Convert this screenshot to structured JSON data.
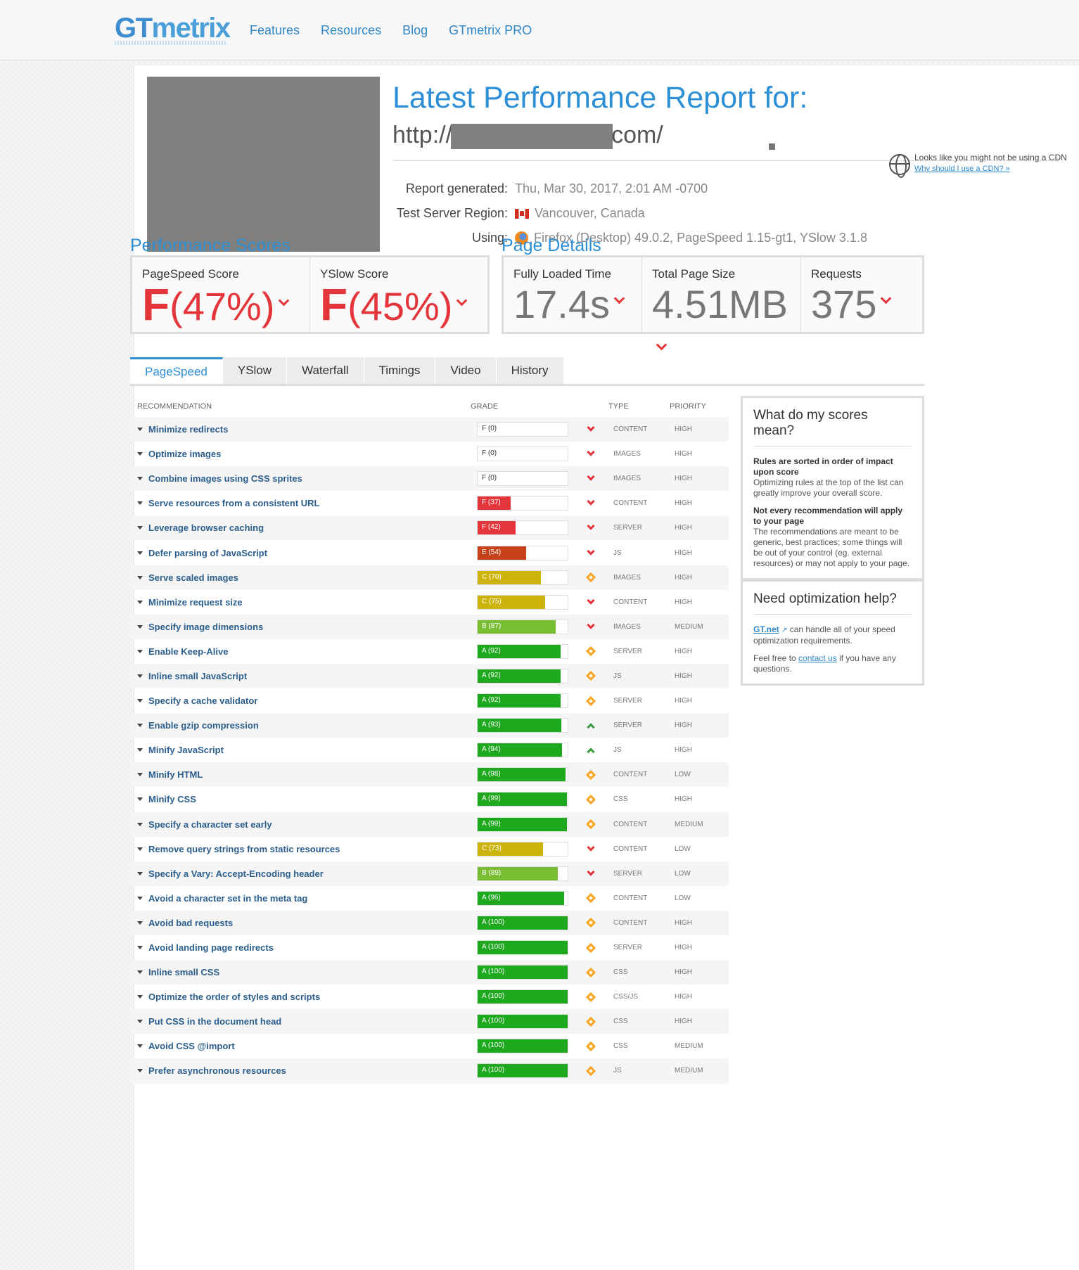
{
  "header": {
    "logo_gt": "GT",
    "logo_rest": "metrix",
    "nav": [
      "Features",
      "Resources",
      "Blog",
      "GTmetrix PRO"
    ]
  },
  "report": {
    "title": "Latest Performance Report for:",
    "url_prefix": "http://",
    "url_suffix": "com/",
    "generated_label": "Report generated:",
    "generated_value": "Thu, Mar 30, 2017, 2:01 AM -0700",
    "region_label": "Test Server Region:",
    "region_value": "Vancouver, Canada",
    "using_label": "Using:",
    "using_value": "Firefox (Desktop) 49.0.2, PageSpeed 1.15-gt1, YSlow 3.1.8",
    "cdn_text": "Looks like you might not be using a CDN",
    "cdn_link": "Why should I use a CDN? »"
  },
  "scores": {
    "heading": "Performance Scores",
    "pagespeed_label": "PageSpeed Score",
    "pagespeed_grade": "F",
    "pagespeed_pct": "(47%)",
    "yslow_label": "YSlow Score",
    "yslow_grade": "F",
    "yslow_pct": "(45%)"
  },
  "details": {
    "heading": "Page Details",
    "load_label": "Fully Loaded Time",
    "load_value": "17.4s",
    "size_label": "Total Page Size",
    "size_value": "4.51MB",
    "req_label": "Requests",
    "req_value": "375"
  },
  "tabs": [
    "PageSpeed",
    "YSlow",
    "Waterfall",
    "Timings",
    "Video",
    "History"
  ],
  "table": {
    "headers": {
      "rec": "RECOMMENDATION",
      "grade": "GRADE",
      "type": "TYPE",
      "priority": "PRIORITY"
    },
    "rows": [
      {
        "rec": "Minimize redirects",
        "grade": "F (0)",
        "score": 0,
        "color": "#e3353a",
        "ind": "down",
        "type": "CONTENT",
        "priority": "HIGH"
      },
      {
        "rec": "Optimize images",
        "grade": "F (0)",
        "score": 0,
        "color": "#e3353a",
        "ind": "down",
        "type": "IMAGES",
        "priority": "HIGH"
      },
      {
        "rec": "Combine images using CSS sprites",
        "grade": "F (0)",
        "score": 0,
        "color": "#e3353a",
        "ind": "down",
        "type": "IMAGES",
        "priority": "HIGH"
      },
      {
        "rec": "Serve resources from a consistent URL",
        "grade": "F (37)",
        "score": 37,
        "color": "#e3353a",
        "ind": "down",
        "type": "CONTENT",
        "priority": "HIGH"
      },
      {
        "rec": "Leverage browser caching",
        "grade": "F (42)",
        "score": 42,
        "color": "#e3353a",
        "ind": "down",
        "type": "SERVER",
        "priority": "HIGH"
      },
      {
        "rec": "Defer parsing of JavaScript",
        "grade": "E (54)",
        "score": 54,
        "color": "#c6401a",
        "ind": "down",
        "type": "JS",
        "priority": "HIGH"
      },
      {
        "rec": "Serve scaled images",
        "grade": "C (70)",
        "score": 70,
        "color": "#cdb40c",
        "ind": "diamond",
        "type": "IMAGES",
        "priority": "HIGH"
      },
      {
        "rec": "Minimize request size",
        "grade": "C (75)",
        "score": 75,
        "color": "#cdb40c",
        "ind": "down",
        "type": "CONTENT",
        "priority": "HIGH"
      },
      {
        "rec": "Specify image dimensions",
        "grade": "B (87)",
        "score": 87,
        "color": "#79bd32",
        "ind": "down",
        "type": "IMAGES",
        "priority": "MEDIUM"
      },
      {
        "rec": "Enable Keep-Alive",
        "grade": "A (92)",
        "score": 92,
        "color": "#1ea81e",
        "ind": "diamond",
        "type": "SERVER",
        "priority": "HIGH"
      },
      {
        "rec": "Inline small JavaScript",
        "grade": "A (92)",
        "score": 92,
        "color": "#1ea81e",
        "ind": "diamond",
        "type": "JS",
        "priority": "HIGH"
      },
      {
        "rec": "Specify a cache validator",
        "grade": "A (92)",
        "score": 92,
        "color": "#1ea81e",
        "ind": "diamond",
        "type": "SERVER",
        "priority": "HIGH"
      },
      {
        "rec": "Enable gzip compression",
        "grade": "A (93)",
        "score": 93,
        "color": "#1ea81e",
        "ind": "up",
        "type": "SERVER",
        "priority": "HIGH"
      },
      {
        "rec": "Minify JavaScript",
        "grade": "A (94)",
        "score": 94,
        "color": "#1ea81e",
        "ind": "up",
        "type": "JS",
        "priority": "HIGH"
      },
      {
        "rec": "Minify HTML",
        "grade": "A (98)",
        "score": 98,
        "color": "#1ea81e",
        "ind": "diamond",
        "type": "CONTENT",
        "priority": "LOW"
      },
      {
        "rec": "Minify CSS",
        "grade": "A (99)",
        "score": 99,
        "color": "#1ea81e",
        "ind": "diamond",
        "type": "CSS",
        "priority": "HIGH"
      },
      {
        "rec": "Specify a character set early",
        "grade": "A (99)",
        "score": 99,
        "color": "#1ea81e",
        "ind": "diamond",
        "type": "CONTENT",
        "priority": "MEDIUM"
      },
      {
        "rec": "Remove query strings from static resources",
        "grade": "C (73)",
        "score": 73,
        "color": "#cdb40c",
        "ind": "down",
        "type": "CONTENT",
        "priority": "LOW"
      },
      {
        "rec": "Specify a Vary: Accept-Encoding header",
        "grade": "B (89)",
        "score": 89,
        "color": "#79bd32",
        "ind": "down",
        "type": "SERVER",
        "priority": "LOW"
      },
      {
        "rec": "Avoid a character set in the meta tag",
        "grade": "A (96)",
        "score": 96,
        "color": "#1ea81e",
        "ind": "diamond",
        "type": "CONTENT",
        "priority": "LOW"
      },
      {
        "rec": "Avoid bad requests",
        "grade": "A (100)",
        "score": 100,
        "color": "#1ea81e",
        "ind": "diamond",
        "type": "CONTENT",
        "priority": "HIGH"
      },
      {
        "rec": "Avoid landing page redirects",
        "grade": "A (100)",
        "score": 100,
        "color": "#1ea81e",
        "ind": "diamond",
        "type": "SERVER",
        "priority": "HIGH"
      },
      {
        "rec": "Inline small CSS",
        "grade": "A (100)",
        "score": 100,
        "color": "#1ea81e",
        "ind": "diamond",
        "type": "CSS",
        "priority": "HIGH"
      },
      {
        "rec": "Optimize the order of styles and scripts",
        "grade": "A (100)",
        "score": 100,
        "color": "#1ea81e",
        "ind": "diamond",
        "type": "CSS/JS",
        "priority": "HIGH"
      },
      {
        "rec": "Put CSS in the document head",
        "grade": "A (100)",
        "score": 100,
        "color": "#1ea81e",
        "ind": "diamond",
        "type": "CSS",
        "priority": "HIGH"
      },
      {
        "rec": "Avoid CSS @import",
        "grade": "A (100)",
        "score": 100,
        "color": "#1ea81e",
        "ind": "diamond",
        "type": "CSS",
        "priority": "MEDIUM"
      },
      {
        "rec": "Prefer asynchronous resources",
        "grade": "A (100)",
        "score": 100,
        "color": "#1ea81e",
        "ind": "diamond",
        "type": "JS",
        "priority": "MEDIUM"
      }
    ]
  },
  "sidebar": {
    "scores_title": "What do my scores mean?",
    "scores_b1": "Rules are sorted in order of impact upon score",
    "scores_t1": "Optimizing rules at the top of the list can greatly improve your overall score.",
    "scores_b2": "Not every recommendation will apply to your page",
    "scores_t2": "The recommendations are meant to be generic, best practices; some things will be out of your control (eg. external resources) or may not apply to your page.",
    "help_title": "Need optimization help?",
    "help_link": "GT.net",
    "help_t1": "can handle all of your speed optimization requirements.",
    "help_t2a": "Feel free to",
    "help_contact": "contact us",
    "help_t2b": "if you have any questions."
  }
}
